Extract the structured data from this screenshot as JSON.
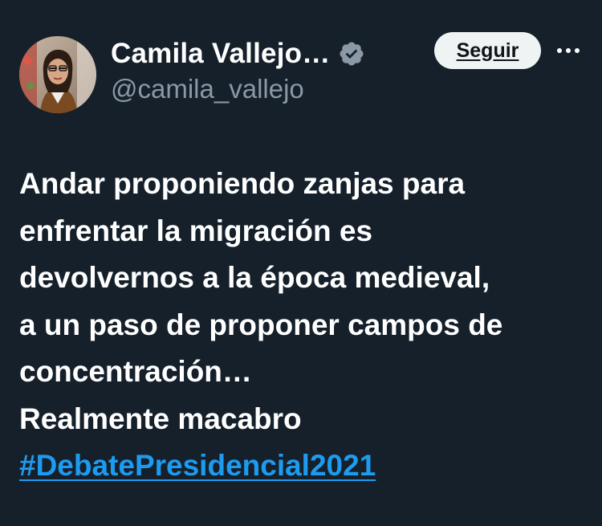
{
  "author": {
    "display_name": "Camila Vallejo…",
    "handle": "@camila_vallejo",
    "verified_icon": "verified-badge-icon"
  },
  "actions": {
    "follow_label": "Seguir",
    "more_icon": "more-options-icon"
  },
  "tweet": {
    "lines": [
      "Andar proponiendo zanjas para",
      "enfrentar la migración es",
      "devolvernos a la época medieval,",
      "a un paso de proponer campos de",
      "concentración…",
      "Realmente macabro"
    ],
    "hashtag": "#DebatePresidencial2021"
  },
  "colors": {
    "background": "#15202b",
    "text": "#ffffff",
    "secondary": "#8b98a5",
    "link": "#1d9bf0",
    "button_bg": "#eff3f4"
  }
}
